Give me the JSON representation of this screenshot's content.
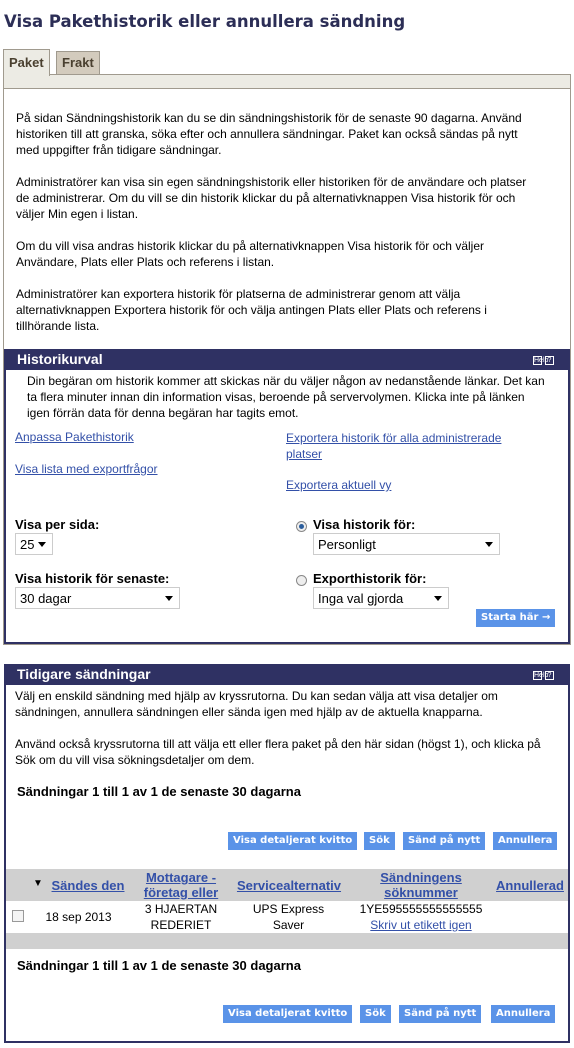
{
  "page_title": "Visa Pakethistorik eller annullera sändning",
  "tabs": [
    {
      "label": "Paket",
      "active": true
    },
    {
      "label": "Frakt",
      "active": false
    }
  ],
  "intro": [
    "På sidan Sändningshistorik kan du se din sändningshistorik för de senaste 90 dagarna. Använd historiken till att granska, söka efter och annullera sändningar. Paket kan också sändas på nytt med uppgifter från tidigare sändningar.",
    "Administratörer kan visa sin egen sändningshistorik eller historiken för de användare och platser de administrerar. Om du vill se din historik klickar du på alternativknappen Visa historik för och väljer Min egen i listan.",
    "Om du vill visa andras historik klickar du på alternativknappen Visa historik för och väljer Användare, Plats eller Plats och referens i listan.",
    "Administratörer kan exportera historik för platserna de administrerar genom att välja alternativknappen Exportera historik för och välja antingen Plats eller Plats och referens i tillhörande lista."
  ],
  "history": {
    "title": "Historikurval",
    "help": "Help",
    "notice": "Din begäran om historik kommer att skickas när du väljer någon av nedanstående länkar. Det kan ta flera minuter innan din information visas, beroende på servervolymen. Klicka inte på länken igen förrän data för denna begäran har tagits emot.",
    "links": {
      "customize": "Anpassa Pakethistorik",
      "export_list": "Visa lista med exportfrågor",
      "export_all": "Exportera historik för alla administrerade platser",
      "export_current": "Exportera aktuell vy"
    },
    "per_page_label": "Visa per sida:",
    "per_page_value": "25",
    "recent_label": "Visa historik för senaste:",
    "recent_value": "30 dagar",
    "view_for_label": "Visa historik för:",
    "view_for_value": "Personligt",
    "view_for_selected": true,
    "export_for_label": "Exporthistorik för:",
    "export_for_value": "Inga val gjorda",
    "export_for_selected": false,
    "start_button": "Starta här"
  },
  "shipments": {
    "title": "Tidigare sändningar",
    "help": "Help",
    "intro1": "Välj en enskild sändning med hjälp av kryssrutorna. Du kan sedan välja att visa detaljer om sändningen, annullera sändningen eller sända igen med hjälp av de aktuella knapparna.",
    "intro2": "Använd också kryssrutorna till att välja ett eller flera paket på den här sidan (högst 1), och klicka på Sök om du vill visa sökningsdetaljer om dem.",
    "count": "Sändningar 1 till 1 av 1 de senaste 30 dagarna",
    "buttons": {
      "receipt": "Visa detaljerat kvitto",
      "search": "Sök",
      "resend": "Sänd på nytt",
      "cancel": "Annullera"
    },
    "columns": [
      "Sändes den",
      "Mottagare - företag eller",
      "Servicealternativ",
      "Sändningens söknummer",
      "Annullerad"
    ],
    "rows": [
      {
        "date": "18 sep 2013",
        "recipient": "3 HJAERTAN REDERIET",
        "service": "UPS Express Saver",
        "tracking": "1YE595555555555555",
        "reprint": "Skriv ut etikett igen",
        "cancelled": ""
      }
    ]
  },
  "colors": {
    "header": "#2f3163",
    "button": "#5a93e8",
    "link": "#3350a8"
  }
}
